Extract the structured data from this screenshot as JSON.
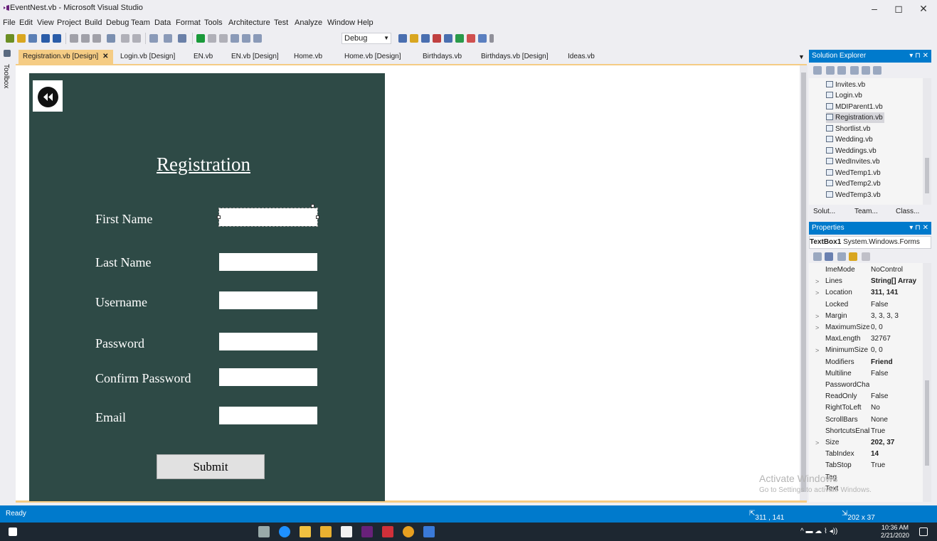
{
  "window": {
    "title": "EventNest.vb - Microsoft Visual Studio",
    "minimize": "–",
    "maximize": "◻",
    "close": "✕"
  },
  "menu": [
    "File",
    "Edit",
    "View",
    "Project",
    "Build",
    "Debug",
    "Team",
    "Data",
    "Format",
    "Tools",
    "Architecture",
    "Test",
    "Analyze",
    "Window",
    "Help"
  ],
  "toolbar": {
    "config": "Debug"
  },
  "toolbox_label": "Toolbox",
  "tabs": [
    "Registration.vb [Design]",
    "Login.vb [Design]",
    "EN.vb",
    "EN.vb [Design]",
    "Home.vb",
    "Home.vb [Design]",
    "Birthdays.vb",
    "Birthdays.vb [Design]",
    "Ideas.vb"
  ],
  "form": {
    "title": "Registration",
    "fields": [
      {
        "label": "First Name"
      },
      {
        "label": "Last Name"
      },
      {
        "label": "Username"
      },
      {
        "label": "Password"
      },
      {
        "label": "Confirm Password"
      },
      {
        "label": "Email"
      }
    ],
    "submit": "Submit"
  },
  "solution_explorer": {
    "title": "Solution Explorer",
    "items": [
      "Invites.vb",
      "Login.vb",
      "MDIParent1.vb",
      "Registration.vb",
      "Shortlist.vb",
      "Wedding.vb",
      "Weddings.vb",
      "WedInvites.vb",
      "WedTemp1.vb",
      "WedTemp2.vb",
      "WedTemp3.vb"
    ],
    "bottom_tabs": [
      "Solut...",
      "Team...",
      "Class..."
    ]
  },
  "properties": {
    "title": "Properties",
    "object_name": "TextBox1",
    "object_type": "System.Windows.Forms",
    "rows": [
      {
        "expand": "",
        "name": "ImeMode",
        "value": "NoControl",
        "bold": false
      },
      {
        "expand": ">",
        "name": "Lines",
        "value": "String[] Array",
        "bold": true
      },
      {
        "expand": ">",
        "name": "Location",
        "value": "311, 141",
        "bold": true
      },
      {
        "expand": "",
        "name": "Locked",
        "value": "False",
        "bold": false
      },
      {
        "expand": ">",
        "name": "Margin",
        "value": "3, 3, 3, 3",
        "bold": false
      },
      {
        "expand": ">",
        "name": "MaximumSize",
        "value": "0, 0",
        "bold": false
      },
      {
        "expand": "",
        "name": "MaxLength",
        "value": "32767",
        "bold": false
      },
      {
        "expand": ">",
        "name": "MinimumSize",
        "value": "0, 0",
        "bold": false
      },
      {
        "expand": "",
        "name": "Modifiers",
        "value": "Friend",
        "bold": true
      },
      {
        "expand": "",
        "name": "Multiline",
        "value": "False",
        "bold": false
      },
      {
        "expand": "",
        "name": "PasswordChar",
        "value": "",
        "bold": false
      },
      {
        "expand": "",
        "name": "ReadOnly",
        "value": "False",
        "bold": false
      },
      {
        "expand": "",
        "name": "RightToLeft",
        "value": "No",
        "bold": false
      },
      {
        "expand": "",
        "name": "ScrollBars",
        "value": "None",
        "bold": false
      },
      {
        "expand": "",
        "name": "ShortcutsEnabled",
        "value": "True",
        "bold": false
      },
      {
        "expand": ">",
        "name": "Size",
        "value": "202, 37",
        "bold": true
      },
      {
        "expand": "",
        "name": "TabIndex",
        "value": "14",
        "bold": true
      },
      {
        "expand": "",
        "name": "TabStop",
        "value": "True",
        "bold": false
      },
      {
        "expand": "",
        "name": "Tag",
        "value": "",
        "bold": false
      },
      {
        "expand": "",
        "name": "Text",
        "value": "",
        "bold": false
      }
    ]
  },
  "watermark": {
    "line1": "Activate Windows",
    "line2": "Go to Settings to activate Windows."
  },
  "status": {
    "left": "Ready",
    "position": "311 , 141",
    "size": "202 x 37"
  },
  "taskbar": {
    "time": "10:36 AM",
    "date": "2/21/2020"
  }
}
